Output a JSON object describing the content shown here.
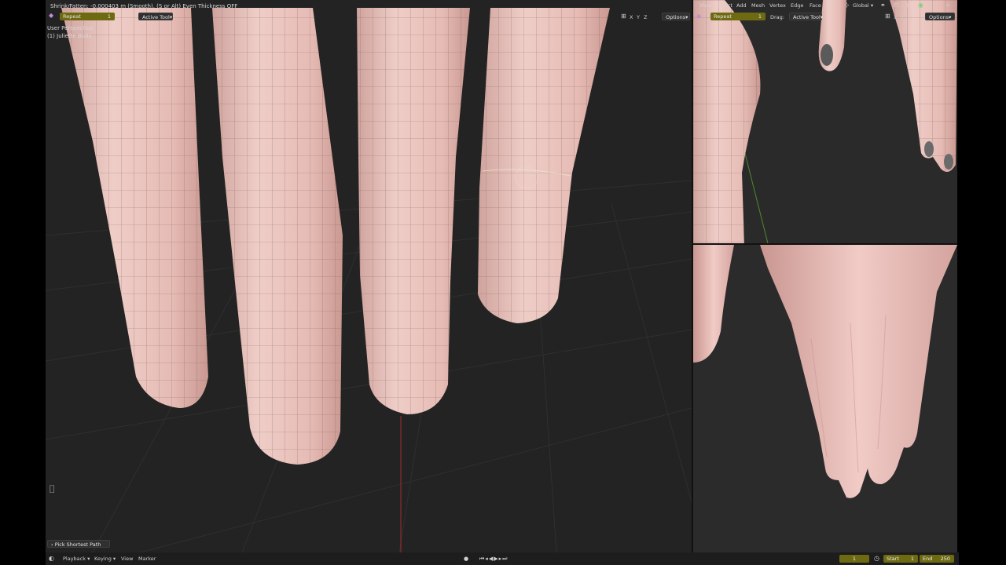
{
  "status_text": "Shrink/Fatten: -0.000403 m (Smooth), (S or Alt) Even Thickness OFF",
  "main_viewport": {
    "view_name": "User Perspective",
    "object_name": "(1) Juliette Body",
    "repeat_label": "Repeat",
    "repeat_value": "1",
    "active_tool_label": "Active Tool",
    "axes": [
      "X",
      "Y",
      "Z"
    ],
    "options_label": "Options",
    "last_operator": "Pick Shortest Path"
  },
  "side_viewport": {
    "menu": [
      "View",
      "Select",
      "Add",
      "Mesh",
      "Vertex",
      "Edge",
      "Face",
      "UV"
    ],
    "orientation": "Global",
    "repeat_label": "Repeat",
    "repeat_value": "1",
    "drag_label": "Drag:",
    "active_tool_label": "Active Tool",
    "axes": [
      "X",
      "Y",
      "Z"
    ],
    "options_label": "Options"
  },
  "timeline": {
    "playback_label": "Playback",
    "keying_label": "Keying",
    "view_label": "View",
    "marker_label": "Marker",
    "current_frame": "1",
    "start_label": "Start",
    "start_value": "1",
    "end_label": "End",
    "end_value": "250"
  },
  "icons": {
    "mouse": "mouse-icon",
    "clock": "clock-icon",
    "record": "record-icon",
    "transport": "playback-controls-icon",
    "editor_type": "editor-type-icon",
    "overlay": "overlay-icon",
    "snap": "snap-icon",
    "proportional": "proportional-edit-icon",
    "orientation": "transform-orientation-icon"
  },
  "colors": {
    "viewport_bg": "#232323",
    "skin": "#e8bdb6",
    "accent_olive": "#6d6a12",
    "x_axis": "#a02c2c",
    "y_axis": "#4e8a2c"
  }
}
